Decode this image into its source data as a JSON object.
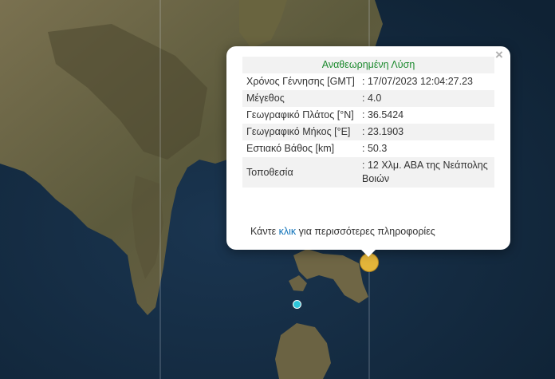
{
  "popup": {
    "title": "Αναθεωρημένη Λύση",
    "rows": [
      {
        "label": "Χρόνος Γέννησης [GMT]",
        "value": ": 17/07/2023 12:04:27.23"
      },
      {
        "label": "Μέγεθος",
        "value": ": 4.0"
      },
      {
        "label": "Γεωγραφικό Πλάτος [°N]",
        "value": ": 36.5424"
      },
      {
        "label": "Γεωγραφικό Μήκος [°E]",
        "value": ": 23.1903"
      },
      {
        "label": "Εστιακό Βάθος [km]",
        "value": ": 50.3"
      },
      {
        "label": "Τοποθεσία",
        "value": ": 12 Χλμ. ΑΒΑ της Νεάπολης Βοιών"
      }
    ],
    "more_prefix": "Κάντε ",
    "more_link": "κλικ",
    "more_suffix": " για περισσότερες πληροφορίες",
    "close_symbol": "×"
  },
  "colors": {
    "sea": "#13283c",
    "land": "#6b6444",
    "marker_main": "#e3b53a",
    "marker_small": "#2ec6da",
    "title_text": "#1c8a2e",
    "link": "#0a6fb8"
  },
  "icons": {
    "close": "close-icon",
    "main_marker": "earthquake-marker-icon",
    "small_marker": "earthquake-marker-icon"
  }
}
